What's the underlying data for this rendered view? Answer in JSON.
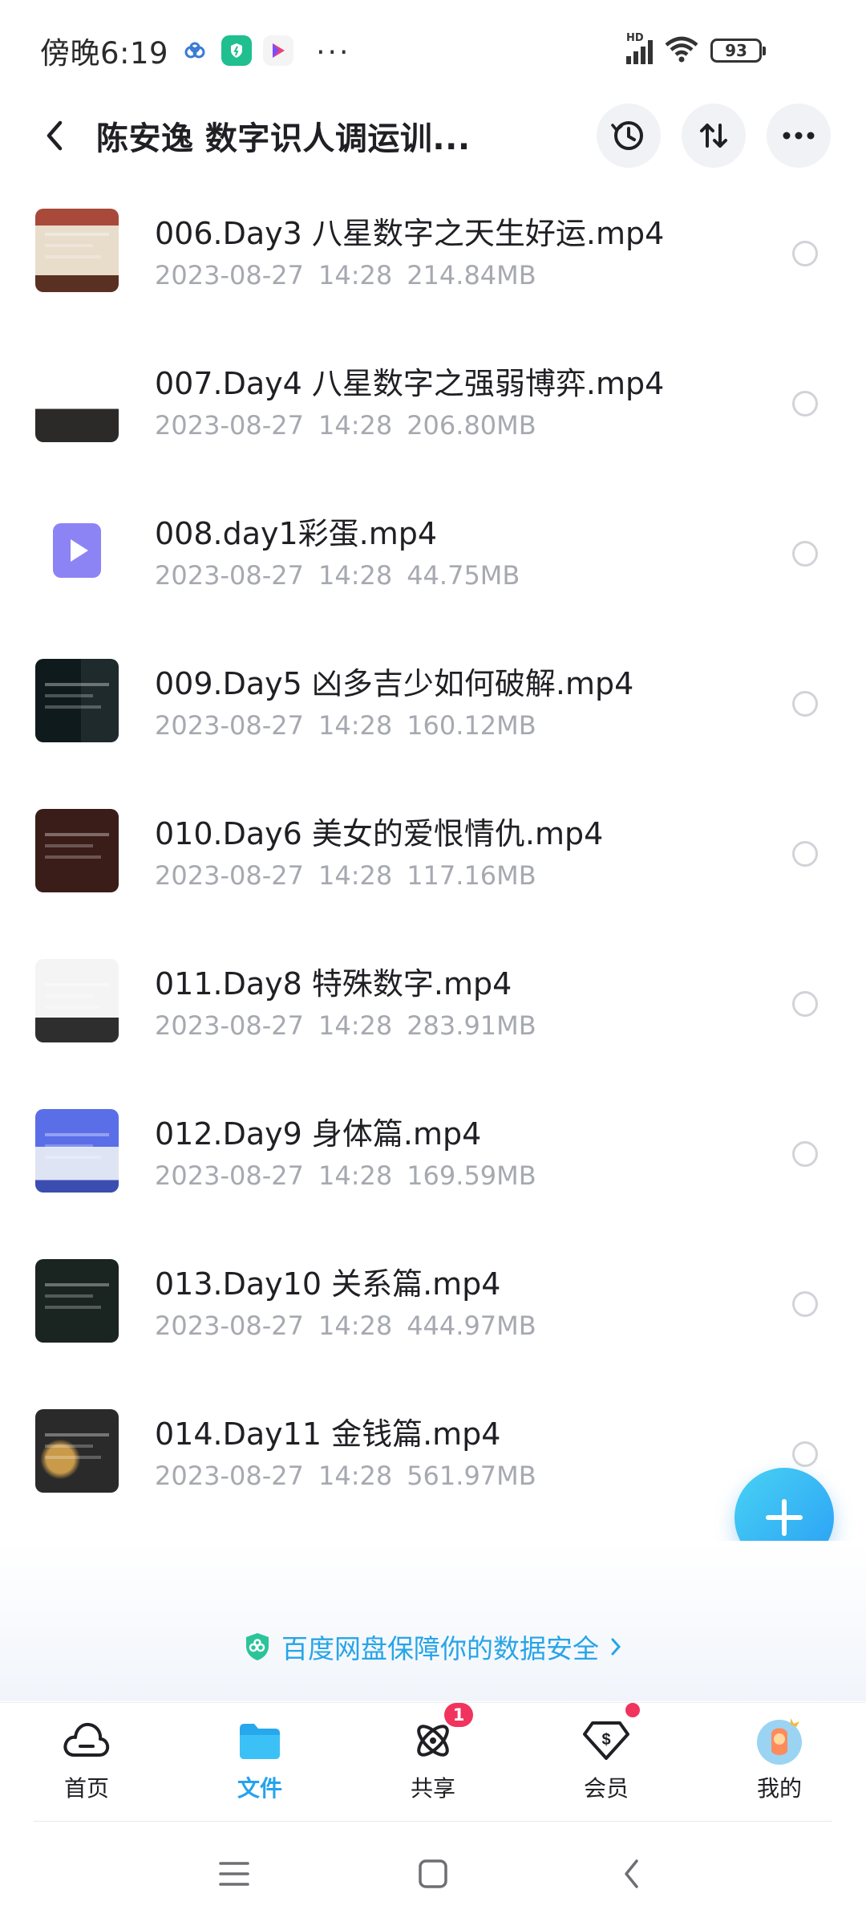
{
  "status_bar": {
    "time": "傍晚6:19",
    "network": "HD",
    "battery": "93"
  },
  "header": {
    "title": "陈安逸 数字识人调运训..."
  },
  "files": [
    {
      "name": "006.Day3 八星数字之天生好运.mp4",
      "date": "2023-08-27",
      "time": "14:28",
      "size": "214.84MB",
      "thumb": "video"
    },
    {
      "name": "007.Day4 八星数字之强弱博弈.mp4",
      "date": "2023-08-27",
      "time": "14:28",
      "size": "206.80MB",
      "thumb": "video"
    },
    {
      "name": "008.day1彩蛋.mp4",
      "date": "2023-08-27",
      "time": "14:28",
      "size": "44.75MB",
      "thumb": "video-file-icon"
    },
    {
      "name": "009.Day5 凶多吉少如何破解.mp4",
      "date": "2023-08-27",
      "time": "14:28",
      "size": "160.12MB",
      "thumb": "video"
    },
    {
      "name": "010.Day6 美女的爱恨情仇.mp4",
      "date": "2023-08-27",
      "time": "14:28",
      "size": "117.16MB",
      "thumb": "video"
    },
    {
      "name": "011.Day8 特殊数字.mp4",
      "date": "2023-08-27",
      "time": "14:28",
      "size": "283.91MB",
      "thumb": "video"
    },
    {
      "name": "012.Day9 身体篇.mp4",
      "date": "2023-08-27",
      "time": "14:28",
      "size": "169.59MB",
      "thumb": "video"
    },
    {
      "name": "013.Day10 关系篇.mp4",
      "date": "2023-08-27",
      "time": "14:28",
      "size": "444.97MB",
      "thumb": "video"
    },
    {
      "name": "014.Day11 金钱篇.mp4",
      "date": "2023-08-27",
      "time": "14:28",
      "size": "561.97MB",
      "thumb": "video"
    }
  ],
  "safety_notice": "百度网盘保障你的数据安全",
  "tabs": [
    {
      "label": "首页",
      "icon": "cloud-icon"
    },
    {
      "label": "文件",
      "icon": "folder-icon",
      "active": true
    },
    {
      "label": "共享",
      "icon": "share-atom-icon",
      "badge": "1"
    },
    {
      "label": "会员",
      "icon": "vip-diamond-icon"
    },
    {
      "label": "我的",
      "icon": "avatar"
    }
  ],
  "colors": {
    "accent": "#26a3ec",
    "badge": "#f0345e",
    "meta_text": "#a7a9b1"
  }
}
